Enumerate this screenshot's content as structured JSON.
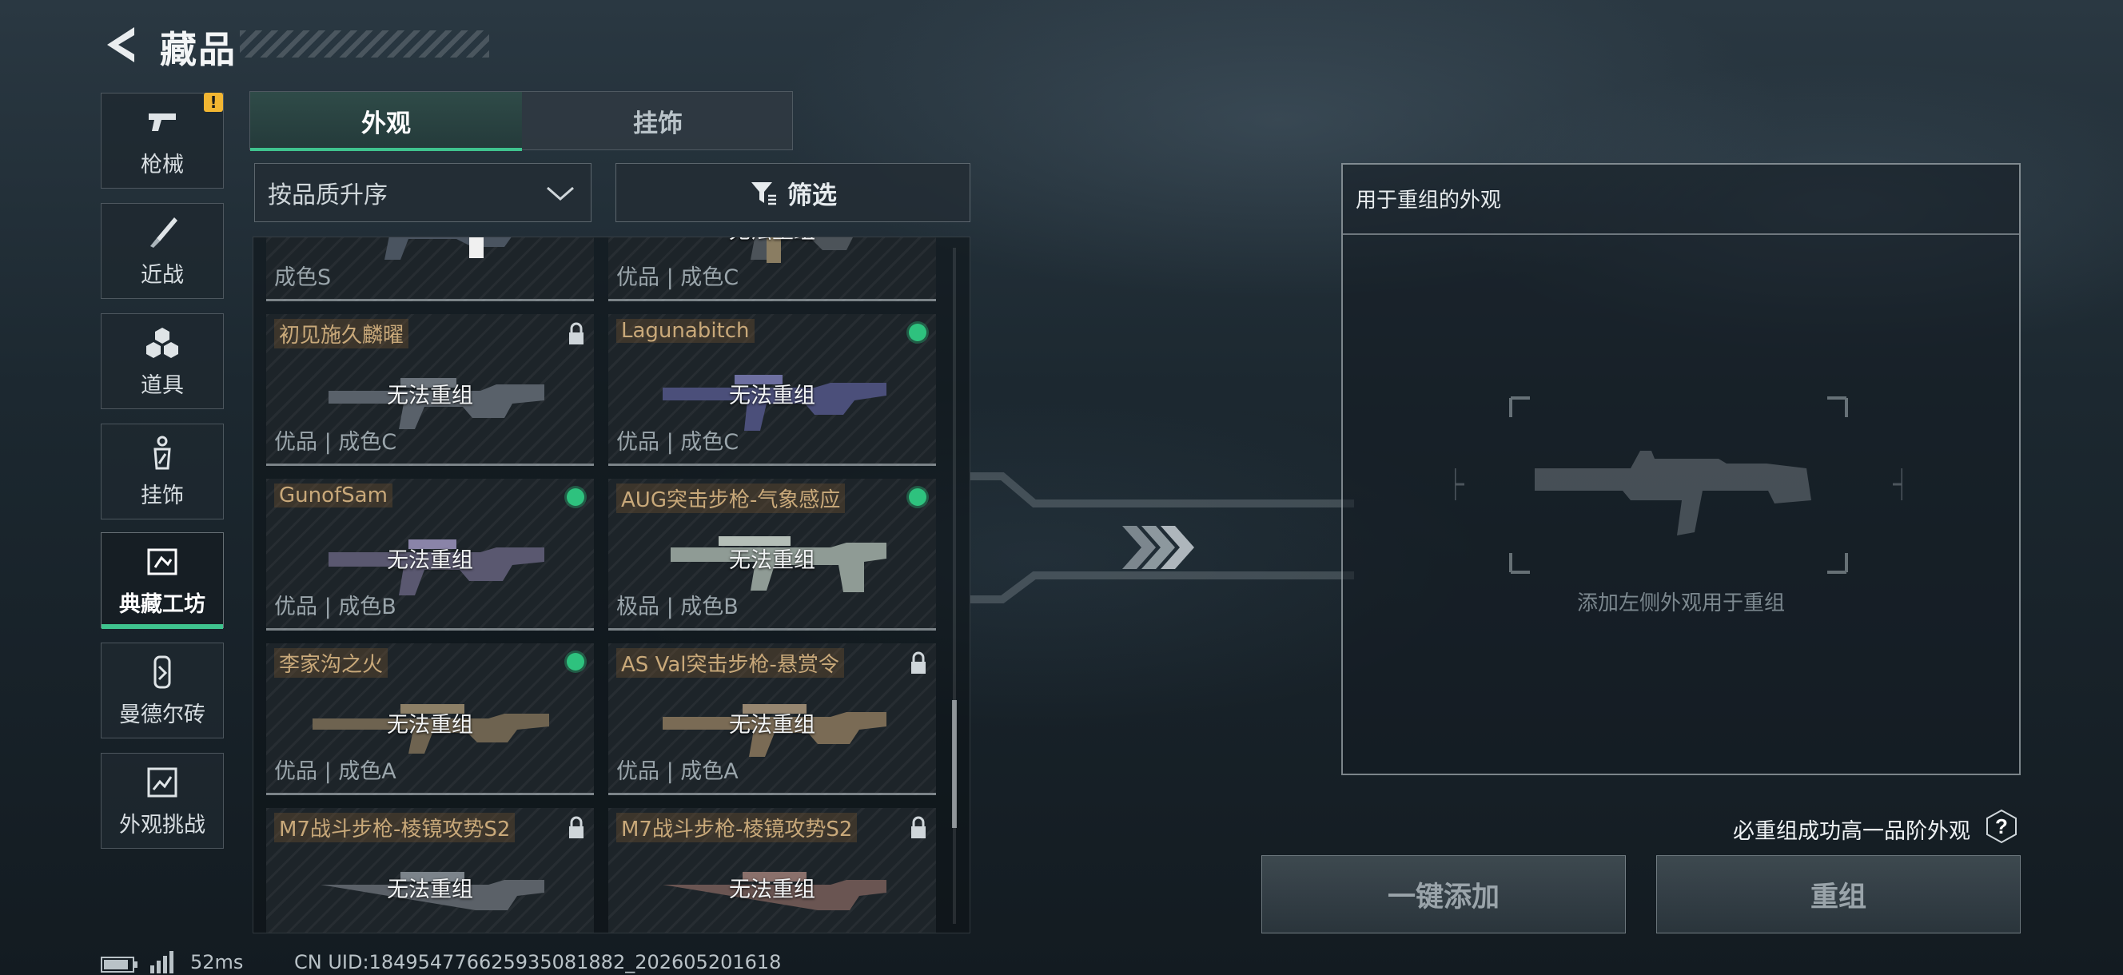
{
  "header": {
    "title": "藏品"
  },
  "sidebar": {
    "items": [
      {
        "label": "枪械",
        "icon": "pistol-icon",
        "warning": "!"
      },
      {
        "label": "近战",
        "icon": "knife-icon"
      },
      {
        "label": "道具",
        "icon": "items-icon"
      },
      {
        "label": "挂饰",
        "icon": "charm-icon"
      },
      {
        "label": "典藏工坊",
        "icon": "workshop-icon",
        "active": true
      },
      {
        "label": "曼德尔砖",
        "icon": "mandel-brick-icon"
      },
      {
        "label": "外观挑战",
        "icon": "challenge-icon"
      }
    ]
  },
  "tabs": [
    {
      "label": "外观",
      "active": true
    },
    {
      "label": "挂饰",
      "active": false
    }
  ],
  "sort": {
    "label": "按品质升序"
  },
  "filter": {
    "label": "筛选"
  },
  "cards": [
    {
      "name": "",
      "grade": "成色S",
      "status": "",
      "badge": "none"
    },
    {
      "name": "",
      "grade": "优品 | 成色C",
      "status": "无法重组",
      "badge": "none"
    },
    {
      "name": "初见施久麟曜",
      "grade": "优品 | 成色C",
      "status": "无法重组",
      "badge": "lock"
    },
    {
      "name": "Lagunabitch",
      "grade": "优品 | 成色C",
      "status": "无法重组",
      "badge": "dot"
    },
    {
      "name": "GunofSam",
      "grade": "优品 | 成色B",
      "status": "无法重组",
      "badge": "dot"
    },
    {
      "name": "AUG突击步枪-气象感应",
      "grade": "极品 | 成色B",
      "status": "无法重组",
      "badge": "dot"
    },
    {
      "name": "李家沟之火",
      "grade": "优品 | 成色A",
      "status": "无法重组",
      "badge": "dot"
    },
    {
      "name": "AS Val突击步枪-悬赏令",
      "grade": "优品 | 成色A",
      "status": "无法重组",
      "badge": "lock"
    },
    {
      "name": "M7战斗步枪-棱镜攻势S2",
      "grade": "",
      "status": "无法重组",
      "badge": "lock"
    },
    {
      "name": "M7战斗步枪-棱镜攻势S2",
      "grade": "",
      "status": "无法重组",
      "badge": "lock"
    }
  ],
  "panel": {
    "title": "用于重组的外观",
    "hint": "添加左侧外观用于重组"
  },
  "guarantee": "必重组成功高一品阶外观",
  "help": "?",
  "buttons": {
    "add": "一键添加",
    "recombine": "重组"
  },
  "status": {
    "ping": "52ms",
    "uid": "CN UID:18495477662593508188​2_202605201618"
  },
  "colors": {
    "accent": "#3fc38e",
    "rarity_dot": "#2ec27e",
    "warning": "#f2b632"
  }
}
